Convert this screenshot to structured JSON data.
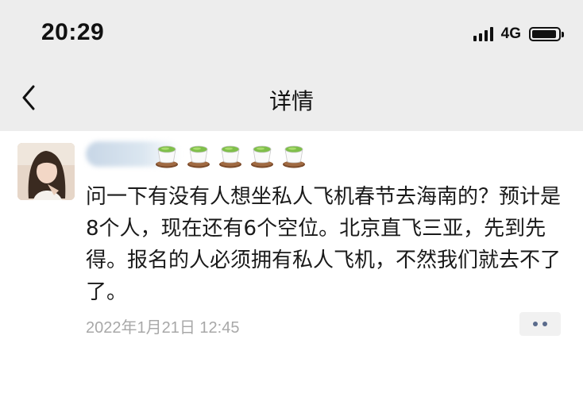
{
  "status_bar": {
    "time": "20:29",
    "network": "4G",
    "icons": [
      "signal-icon",
      "battery-icon"
    ]
  },
  "nav": {
    "title": "详情",
    "back_icon": "chevron-left-icon"
  },
  "post": {
    "emoji_name": "tea-cup-emoji",
    "emoji_count": 5,
    "text": "问一下有没有人想坐私人飞机春节去海南的？预计是8个人，现在还有6个空位。北京直飞三亚，先到先得。报名的人必须拥有私人飞机，不然我们就去不了了。",
    "timestamp": "2022年1月21日 12:45"
  },
  "colors": {
    "topbar_bg": "#ededed",
    "text": "#1a1a1a",
    "timestamp": "#a8a8a8",
    "more_dots": "#5a6b8c"
  }
}
